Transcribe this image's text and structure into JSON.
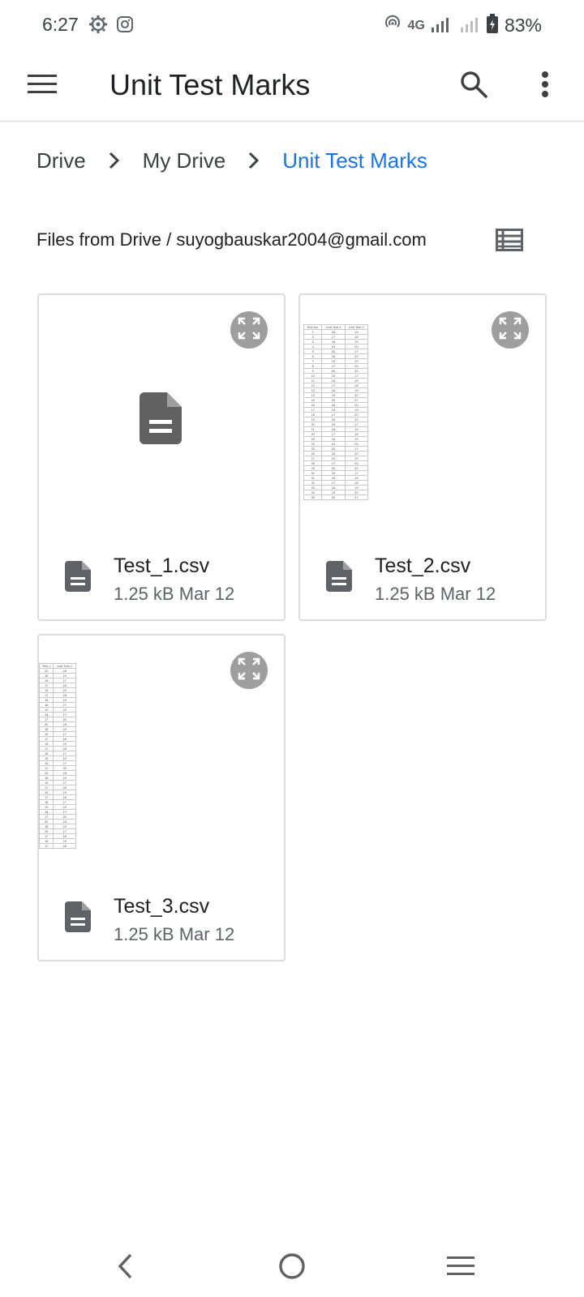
{
  "status_bar": {
    "time": "6:27",
    "network": "4G",
    "battery": "83%",
    "icons": [
      "settings-gear-icon",
      "instagram-icon",
      "hotspot-icon",
      "signal-icon",
      "battery-icon"
    ]
  },
  "app_bar": {
    "title": "Unit Test Marks",
    "icons": [
      "menu-icon",
      "search-icon",
      "more-vert-icon"
    ]
  },
  "breadcrumb": [
    {
      "label": "Drive"
    },
    {
      "label": "My Drive"
    },
    {
      "label": "Unit Test Marks"
    }
  ],
  "section": {
    "header": "Files from Drive / suyogbauskar2004@gmail.com",
    "view_icon": "list-view-icon"
  },
  "files": [
    {
      "name": "Test_1.csv",
      "size": "1.25 kB",
      "date": "Mar 12",
      "preview": "generic-document-icon"
    },
    {
      "name": "Test_2.csv",
      "size": "1.25 kB",
      "date": "Mar 12",
      "preview": "table-thumbnail"
    },
    {
      "name": "Test_3.csv",
      "size": "1.25 kB",
      "date": "Mar 12",
      "preview": "table-thumbnail"
    }
  ],
  "thumb_test2": {
    "headers": [
      "Roll No.",
      "Unit Test 1",
      "Unit Test 2"
    ],
    "rows": [
      [
        "1",
        "18",
        "19"
      ],
      [
        "2",
        "17",
        "18"
      ],
      [
        "3",
        "18",
        "19"
      ],
      [
        "4",
        "19",
        "20"
      ],
      [
        "5",
        "20",
        "17"
      ],
      [
        "6",
        "18",
        "20"
      ],
      [
        "7",
        "15",
        "19"
      ],
      [
        "8",
        "17",
        "20"
      ],
      [
        "9",
        "20",
        "20"
      ],
      [
        "10",
        "19",
        "17"
      ],
      [
        "11",
        "18",
        "19"
      ],
      [
        "12",
        "17",
        "18"
      ],
      [
        "13",
        "18",
        "19"
      ],
      [
        "14",
        "19",
        "20"
      ],
      [
        "15",
        "20",
        "17"
      ],
      [
        "16",
        "18",
        "20"
      ],
      [
        "17",
        "15",
        "19"
      ],
      [
        "18",
        "17",
        "20"
      ],
      [
        "19",
        "20",
        "20"
      ],
      [
        "20",
        "15",
        "17"
      ],
      [
        "21",
        "18",
        "19"
      ],
      [
        "22",
        "17",
        "18"
      ],
      [
        "23",
        "16",
        "19"
      ],
      [
        "24",
        "19",
        "20"
      ],
      [
        "25",
        "20",
        "17"
      ],
      [
        "26",
        "18",
        "20"
      ],
      [
        "27",
        "19",
        "19"
      ],
      [
        "28",
        "17",
        "20"
      ],
      [
        "29",
        "20",
        "20"
      ],
      [
        "30",
        "15",
        "17"
      ],
      [
        "31",
        "18",
        "19"
      ],
      [
        "32",
        "17",
        "18"
      ],
      [
        "33",
        "18",
        "19"
      ],
      [
        "34",
        "19",
        "20"
      ],
      [
        "35",
        "20",
        "17"
      ]
    ]
  },
  "thumb_test3": {
    "headers": [
      "Test 1",
      "Unit Test 2"
    ],
    "rows": [
      [
        "20",
        "18"
      ],
      [
        "18",
        "19"
      ],
      [
        "19",
        "17"
      ],
      [
        "17",
        "18"
      ],
      [
        "15",
        "19"
      ],
      [
        "17",
        "18"
      ],
      [
        "18",
        "19"
      ],
      [
        "18",
        "17"
      ],
      [
        "19",
        "19"
      ],
      [
        "18",
        "17"
      ],
      [
        "17",
        "20"
      ],
      [
        "20",
        "18"
      ],
      [
        "18",
        "19"
      ],
      [
        "19",
        "17"
      ],
      [
        "17",
        "18"
      ],
      [
        "15",
        "19"
      ],
      [
        "17",
        "18"
      ],
      [
        "18",
        "17"
      ],
      [
        "19",
        "19"
      ],
      [
        "18",
        "17"
      ],
      [
        "17",
        "20"
      ],
      [
        "20",
        "18"
      ],
      [
        "18",
        "19"
      ],
      [
        "19",
        "17"
      ],
      [
        "17",
        "18"
      ],
      [
        "15",
        "19"
      ],
      [
        "17",
        "18"
      ],
      [
        "18",
        "17"
      ],
      [
        "19",
        "19"
      ],
      [
        "18",
        "17"
      ],
      [
        "17",
        "20"
      ],
      [
        "20",
        "18"
      ],
      [
        "18",
        "19"
      ],
      [
        "19",
        "17"
      ],
      [
        "17",
        "18"
      ],
      [
        "15",
        "19"
      ],
      [
        "17",
        "18"
      ]
    ]
  },
  "nav_bar": {
    "icons": [
      "back-icon",
      "home-icon",
      "recents-icon"
    ]
  }
}
